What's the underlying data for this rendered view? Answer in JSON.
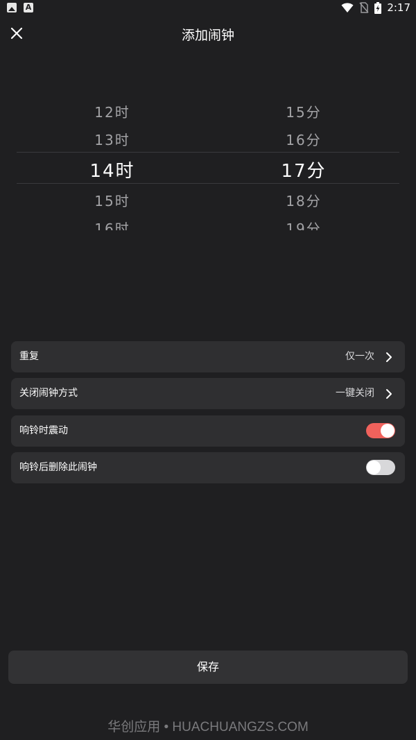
{
  "status_bar": {
    "time": "2:17",
    "icons": [
      "image-notification-icon",
      "a-notification-icon",
      "wifi-icon",
      "no-sim-icon",
      "battery-charging-icon"
    ]
  },
  "header": {
    "title": "添加闹钟",
    "close_icon": "close-icon"
  },
  "picker": {
    "hours": [
      "12时",
      "13时",
      "14时",
      "15时",
      "16时"
    ],
    "minutes": [
      "15分",
      "16分",
      "17分",
      "18分",
      "19分"
    ],
    "selected_index": 2
  },
  "settings": [
    {
      "label": "重复",
      "value": "仅一次",
      "type": "nav"
    },
    {
      "label": "关闭闹钟方式",
      "value": "一键关闭",
      "type": "nav"
    },
    {
      "label": "响铃时震动",
      "type": "toggle",
      "on": true
    },
    {
      "label": "响铃后删除此闹钟",
      "type": "toggle",
      "on": false
    }
  ],
  "save_label": "保存",
  "watermark": "华创应用 • HUACHUANGZS.COM",
  "colors": {
    "background": "#1f1f21",
    "card": "#2f2f31",
    "accent_toggle": "#f0625c"
  }
}
